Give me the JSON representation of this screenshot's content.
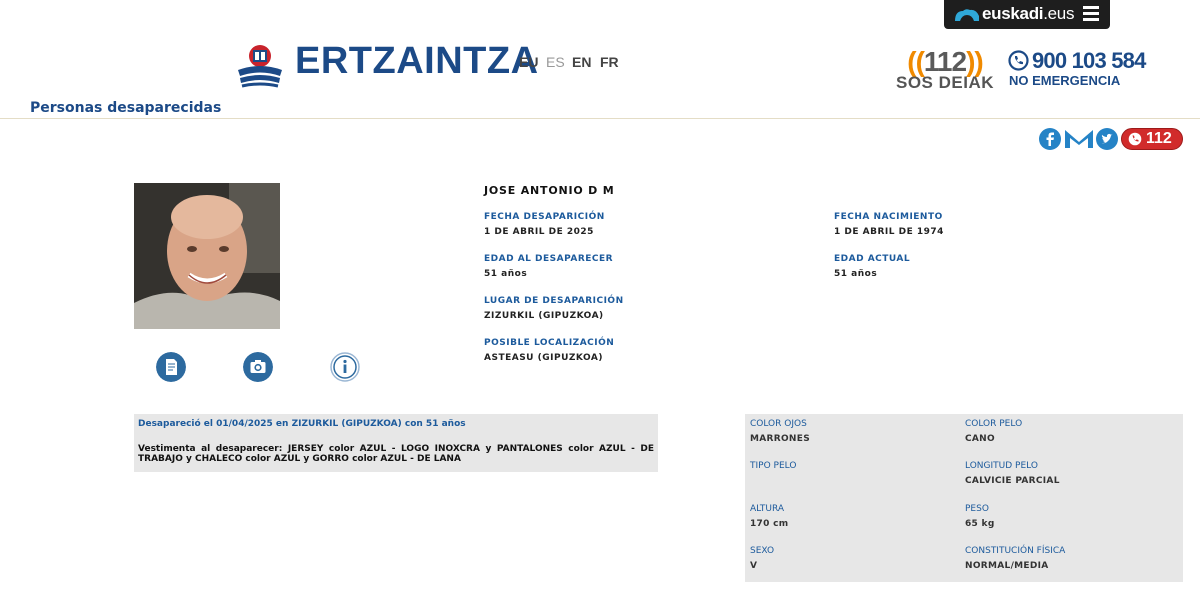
{
  "topbar": {
    "brand_bold": "euskadi",
    "brand_light": ".eus"
  },
  "header": {
    "logo_text": "ERTZAINTZA",
    "languages": [
      "EU",
      "ES",
      "EN",
      "FR"
    ],
    "emergency": {
      "number_open": "((",
      "number": "112",
      "number_close": "))",
      "caption": "SOS DEIAK",
      "phone": "900 103 584",
      "phone_caption": "NO EMERGENCIA"
    }
  },
  "section_title": "Personas desaparecidas",
  "share": {
    "btn112": "112"
  },
  "person": {
    "name": "JOSE ANTONIO D M",
    "fields": [
      {
        "label": "FECHA DESAPARICIÓN",
        "value": "1 DE ABRIL DE 2025"
      },
      {
        "label": "FECHA NACIMIENTO",
        "value": "1 DE ABRIL DE 1974"
      },
      {
        "label": "EDAD AL DESAPARECER",
        "value": "51 años"
      },
      {
        "label": "EDAD ACTUAL",
        "value": "51 años"
      },
      {
        "label": "LUGAR DE DESAPARICIÓN",
        "value": "ZIZURKIL (GIPUZKOA)"
      },
      {
        "label": "POSIBLE LOCALIZACIÓN",
        "value": "ASTEASU (GIPUZKOA)"
      }
    ]
  },
  "summary": {
    "title": "Desapareció el 01/04/2025 en ZIZURKIL (GIPUZKOA) con 51 años",
    "clothing": "Vestimenta al desaparecer: JERSEY color AZUL - LOGO INOXCRA y PANTALONES color AZUL - DE TRABAJO y CHALECO color AZUL y GORRO color AZUL - DE LANA"
  },
  "physical": [
    {
      "label": "COLOR OJOS",
      "value": "MARRONES"
    },
    {
      "label": "COLOR PELO",
      "value": "CANO"
    },
    {
      "label": "TIPO PELO",
      "value": ""
    },
    {
      "label": "LONGITUD PELO",
      "value": "CALVICIE PARCIAL"
    },
    {
      "label": "ALTURA",
      "value": "170 cm"
    },
    {
      "label": "PESO",
      "value": "65 kg"
    },
    {
      "label": "SEXO",
      "value": "V"
    },
    {
      "label": "CONSTITUCIÓN FÍSICA",
      "value": "NORMAL/MEDIA"
    }
  ],
  "colors": {
    "brand_blue": "#1c4a87",
    "link_blue": "#1c5a9c",
    "emergency_orange": "#f08a00",
    "panel_grey": "#e7e7e7"
  },
  "icons": [
    "euskadi-cloud-icon",
    "menu-icon",
    "ertzaintza-emblem-icon",
    "phone-icon",
    "facebook-icon",
    "email-icon",
    "twitter-icon",
    "phone-112-icon",
    "pdf-document-icon",
    "camera-icon",
    "info-icon"
  ]
}
